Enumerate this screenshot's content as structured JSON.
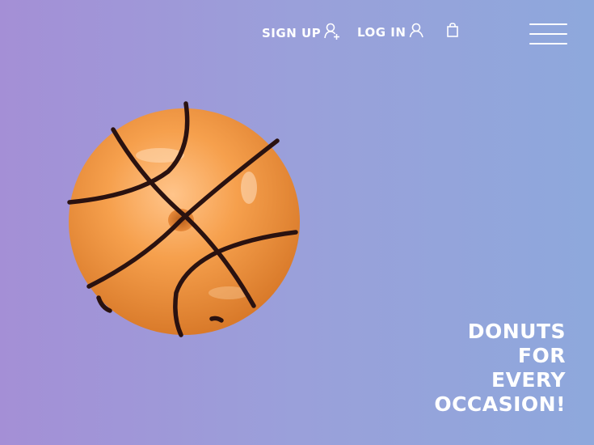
{
  "nav": {
    "signup_label": "Sign Up",
    "login_label": "Log In",
    "signup_icon": "add-user-icon",
    "login_icon": "user-icon",
    "cart_icon": "shopping-bag-icon",
    "menu_icon": "hamburger-menu-icon"
  },
  "hero": {
    "image": "basketball-donut-image",
    "tagline": [
      "Donuts",
      "for",
      "every",
      "occasion!"
    ]
  },
  "colors": {
    "background_start": "#a48fd6",
    "background_end": "#8ea8dc",
    "glaze": "#f29a45",
    "drizzle": "#2a1210",
    "text": "#ffffff"
  }
}
